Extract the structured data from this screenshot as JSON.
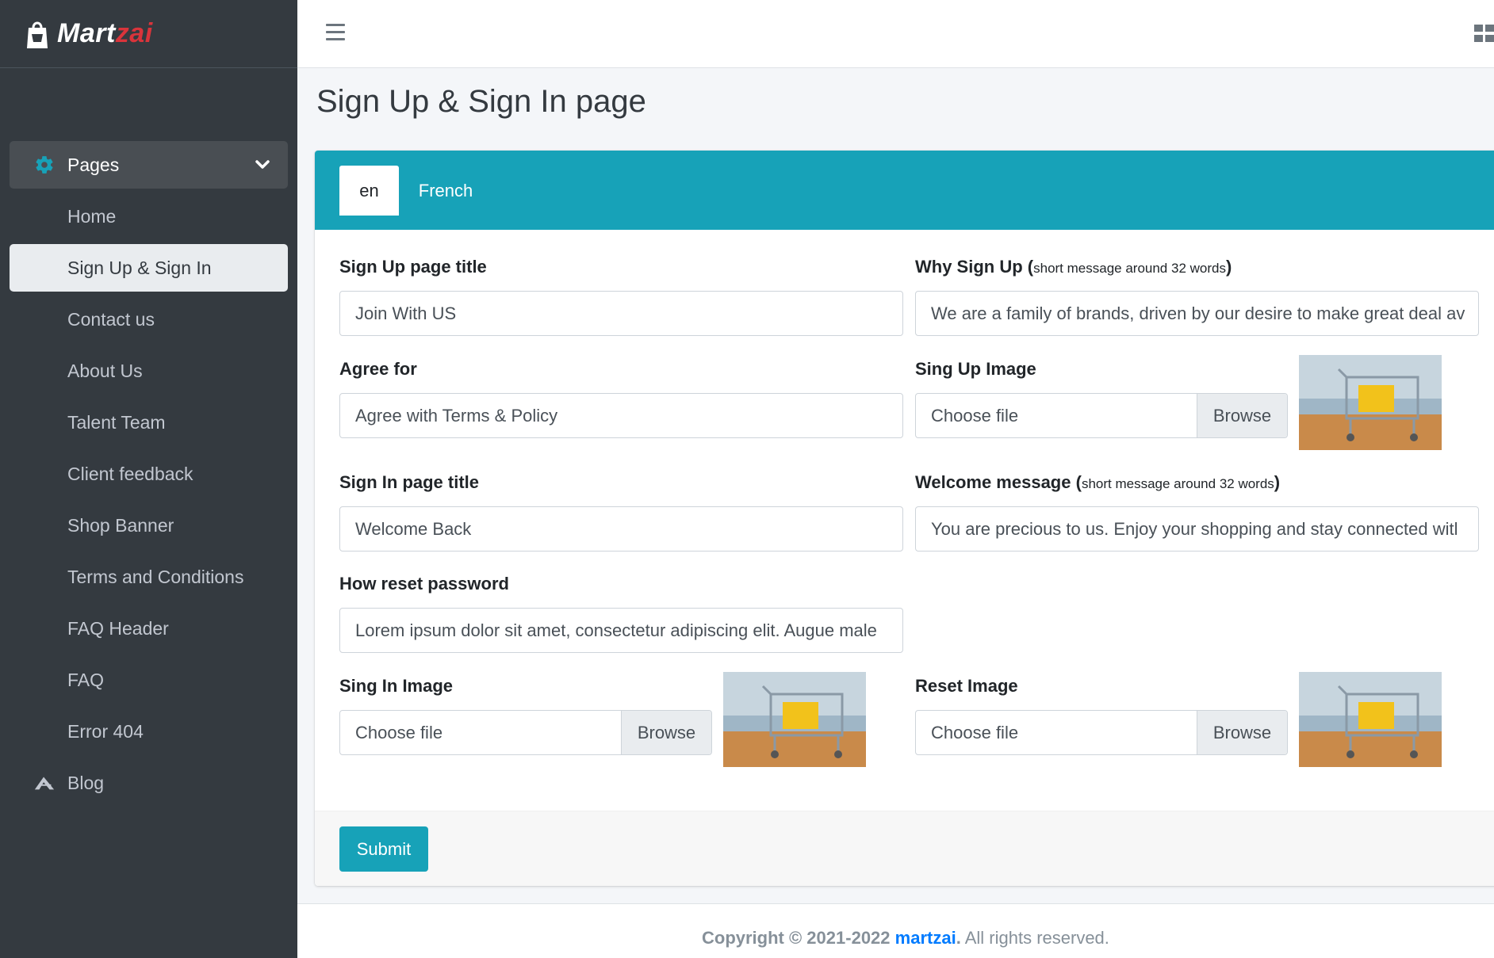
{
  "brand": {
    "name_part1": "Mart",
    "name_part2": "zai",
    "logo_icon": "shopping-bag-icon"
  },
  "sidebar": {
    "parent": {
      "label": "Pages",
      "icon": "gear-icon"
    },
    "items": [
      {
        "label": "Home"
      },
      {
        "label": "Sign Up & Sign In"
      },
      {
        "label": "Contact us"
      },
      {
        "label": "About Us"
      },
      {
        "label": "Talent Team"
      },
      {
        "label": "Client feedback"
      },
      {
        "label": "Shop Banner"
      },
      {
        "label": "Terms and Conditions"
      },
      {
        "label": "FAQ Header"
      },
      {
        "label": "FAQ"
      },
      {
        "label": "Error 404"
      }
    ],
    "blog": {
      "label": "Blog",
      "icon": "blog-icon"
    }
  },
  "header": {
    "menu_icon": "hamburger-icon",
    "apps_icon": "grid-icon"
  },
  "page": {
    "title": "Sign Up & Sign In page"
  },
  "tabs": [
    {
      "label": "en"
    },
    {
      "label": "French"
    }
  ],
  "form": {
    "signup_title": {
      "label": "Sign Up page title",
      "value": "Join With US"
    },
    "why_signup": {
      "label": "Why Sign Up",
      "paren_open": " (",
      "note": "short message around 32 words",
      "paren_close": ")",
      "value": "We are a family of brands, driven by our desire to make great deal av"
    },
    "agree_for": {
      "label": "Agree for",
      "value": "Agree with Terms & Policy"
    },
    "signup_image": {
      "label": "Sing Up Image",
      "file": "Choose file",
      "browse": "Browse"
    },
    "signin_title": {
      "label": "Sign In page title",
      "value": "Welcome Back"
    },
    "welcome_message": {
      "label": "Welcome message",
      "paren_open": " (",
      "note": "short message around 32 words",
      "paren_close": ")",
      "value": "You are precious to us. Enjoy your shopping and stay connected witl"
    },
    "reset_password": {
      "label": "How reset password",
      "value": "Lorem ipsum dolor sit amet, consectetur adipiscing elit. Augue male"
    },
    "signin_image": {
      "label": "Sing In Image",
      "file": "Choose file",
      "browse": "Browse"
    },
    "reset_image": {
      "label": "Reset Image",
      "file": "Choose file",
      "browse": "Browse"
    },
    "submit": "Submit"
  },
  "footer": {
    "copyright": "Copyright © 2021-2022",
    "brand_link": "martzai",
    "dot": ".",
    "rights": " All rights reserved."
  },
  "colors": {
    "sidebar": "#343a40",
    "accent": "#17a2b8",
    "brand_red": "#d9343b",
    "link": "#007bff"
  }
}
